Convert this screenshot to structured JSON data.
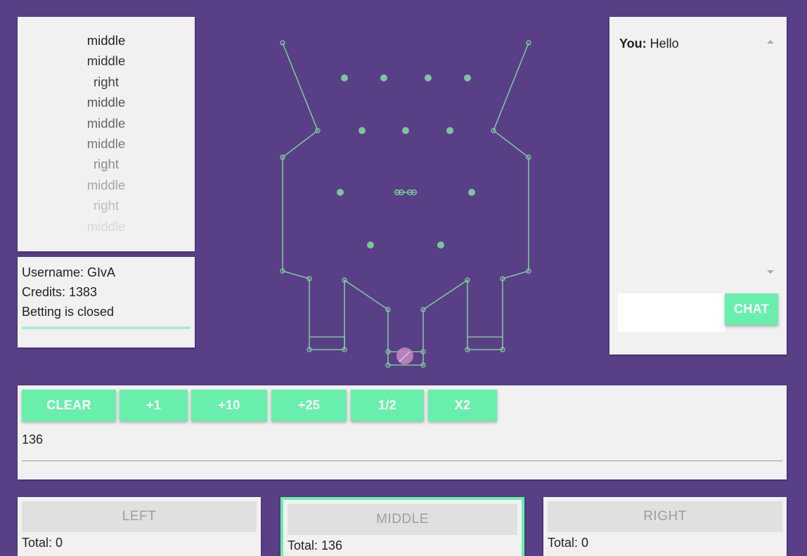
{
  "history": [
    {
      "label": "middle",
      "color": "#222222"
    },
    {
      "label": "middle",
      "color": "#333333"
    },
    {
      "label": "right",
      "color": "#444444"
    },
    {
      "label": "middle",
      "color": "#555555"
    },
    {
      "label": "middle",
      "color": "#666666"
    },
    {
      "label": "middle",
      "color": "#787878"
    },
    {
      "label": "right",
      "color": "#8c8c8c"
    },
    {
      "label": "middle",
      "color": "#a5a5a5"
    },
    {
      "label": "right",
      "color": "#bdbdbd"
    },
    {
      "label": "middle",
      "color": "#d8d8d8"
    }
  ],
  "user": {
    "username": "Username: GIvA",
    "credits": "Credits: 1383",
    "status": "Betting is closed",
    "progress": 1.0
  },
  "chat": {
    "messages": [
      {
        "user": "You:",
        "text": "Hello"
      }
    ],
    "input_value": "",
    "send_label": "CHAT"
  },
  "bet": {
    "buttons": [
      "CLEAR",
      "+1",
      "+10",
      "+25",
      "1/2",
      "X2"
    ],
    "amount": "136"
  },
  "choices": [
    {
      "label": "LEFT",
      "total": "Total: 0",
      "selected": false
    },
    {
      "label": "MIDDLE",
      "total": "Total: 136",
      "selected": true
    },
    {
      "label": "RIGHT",
      "total": "Total: 0",
      "selected": false
    }
  ],
  "colors": {
    "background": "#583f86",
    "accent": "#69efad",
    "board_line": "#7dc59b",
    "ball": "#c88bbf"
  }
}
